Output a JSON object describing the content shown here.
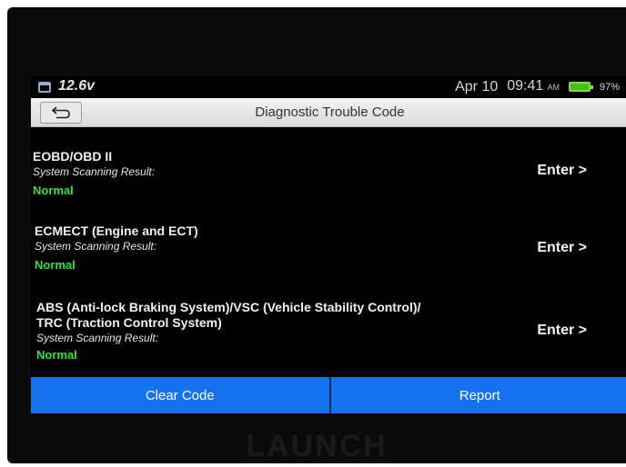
{
  "status_bar": {
    "voltage": "12.6v",
    "date": "Apr 10",
    "time": "09:41",
    "ampm": "AM",
    "battery_percent": "97%"
  },
  "title_bar": {
    "title": "Diagnostic Trouble Code"
  },
  "systems": [
    {
      "name": "EOBD/OBD II",
      "result_label": "System Scanning Result:",
      "status": "Normal",
      "enter_label": "Enter >"
    },
    {
      "name": "ECMECT (Engine and ECT)",
      "result_label": "System Scanning Result:",
      "status": "Normal",
      "enter_label": "Enter >"
    },
    {
      "name_line1": "ABS (Anti-lock Braking System)/VSC (Vehicle Stability Control)/",
      "name_line2": "TRC (Traction Control System)",
      "result_label": "System Scanning Result:",
      "status": "Normal",
      "enter_label": "Enter >"
    }
  ],
  "buttons": {
    "clear_code": "Clear Code",
    "report": "Report"
  },
  "brand": "LAUNCH",
  "icons": {
    "calendar": "calendar-icon",
    "battery": "battery-icon",
    "back": "back-arrow-icon"
  },
  "colors": {
    "status_normal": "#34e23d",
    "button_blue": "#1573f0"
  }
}
